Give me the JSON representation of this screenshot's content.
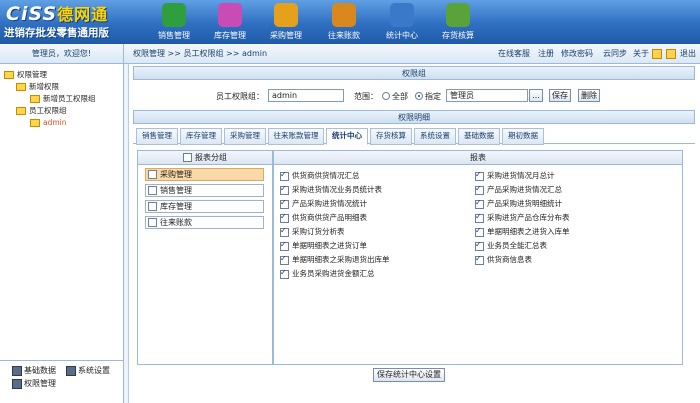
{
  "header": {
    "logo_text": "CiSS",
    "logo_cn": "德网通",
    "slogan": "进销存批发零售通用版",
    "nav": [
      {
        "label": "销售管理",
        "icon": "sales-icon",
        "color": "#2e9e3e"
      },
      {
        "label": "库存管理",
        "icon": "inventory-icon",
        "color": "#c84bb6"
      },
      {
        "label": "采购管理",
        "icon": "purchase-icon",
        "color": "#e5a11c"
      },
      {
        "label": "往来账款",
        "icon": "accounts-icon",
        "color": "#d9881e"
      },
      {
        "label": "统计中心",
        "icon": "statistics-icon",
        "color": "#3a78c9"
      },
      {
        "label": "存货核算",
        "icon": "stock-accounting-icon",
        "color": "#5aa33a"
      }
    ]
  },
  "topbar": {
    "welcome": "管理员，欢迎您!",
    "breadcrumb": "权限管理 >> 员工权限组 >> admin",
    "links": [
      "在线客服",
      "注册",
      "修改密码",
      "云同步",
      "关于",
      "退出"
    ]
  },
  "tree": {
    "root": "权限管理",
    "group1": "新增权限",
    "group1_child": "新增员工权限组",
    "group2": "员工权限组",
    "group2_child": "admin"
  },
  "left_bottom": {
    "items": [
      "基础数据",
      "系统设置",
      "权限管理"
    ]
  },
  "permission_group": {
    "title": "权限组",
    "employee_label": "员工权限组：",
    "employee_value": "admin",
    "scope_label": "范围：",
    "scope_all": "全部",
    "scope_specified": "指定",
    "scope_value": "管理员",
    "browse": "...",
    "save": "保存",
    "delete": "删除"
  },
  "permission_detail": {
    "title": "权限明细",
    "tabs": [
      "销售管理",
      "库存管理",
      "采购管理",
      "往来账款管理",
      "统计中心",
      "存货核算",
      "系统设置",
      "基础数据",
      "期初数据"
    ],
    "active_tab": "统计中心",
    "group_header": "报表分组",
    "report_header": "报表",
    "groups": [
      "采购管理",
      "销售管理",
      "库存管理",
      "往来账款"
    ],
    "selected_group": "采购管理",
    "reports_left": [
      "供货商供货情况汇总",
      "采购进货情况业务员统计表",
      "产品采购进货情况统计",
      "供货商供货产品明细表",
      "采购订货分析表",
      "单据明细表之进货订单",
      "单据明细表之采购退货出库单",
      "业务员采购进货金额汇总"
    ],
    "reports_right": [
      "采购进货情况月总计",
      "产品采购进货情况汇总",
      "产品采购进货明细统计",
      "采购进货产品仓库分布表",
      "单据明细表之进货入库单",
      "业务员全能汇总表",
      "供货商信息表"
    ],
    "save_button": "保存统计中心设置"
  }
}
